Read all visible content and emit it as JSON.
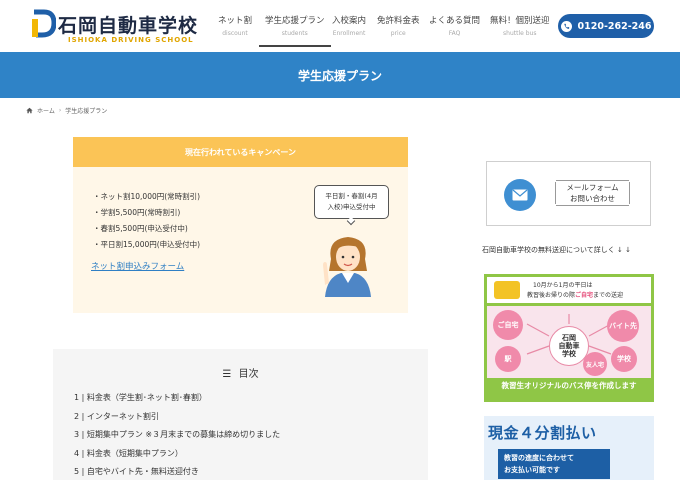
{
  "header": {
    "logo_title": "石岡自動車学校",
    "logo_sub": "ISHIOKA DRIVING SCHOOL",
    "nav": [
      {
        "label": "ネット割",
        "sub": "discount"
      },
      {
        "label": "学生応援プラン",
        "sub": "students"
      },
      {
        "label": "入校案内",
        "sub": "Enrollment"
      },
      {
        "label": "免許料金表",
        "sub": "price"
      },
      {
        "label": "よくある質問",
        "sub": "FAQ"
      },
      {
        "label": "無料！個別送迎",
        "sub": "shuttle bus"
      }
    ],
    "active_nav": "学生応援プラン",
    "tel": "0120-262-246",
    "colors": {
      "tel_button": "#1f5fa8"
    }
  },
  "page_title": "学生応援プラン",
  "breadcrumb": {
    "home": "ホーム",
    "current": "学生応援プラン"
  },
  "campaign": {
    "heading": "現在行われているキャンペーン",
    "items": [
      "・ネット割10,000円(常時割引)",
      "・学割5,500円(常時割引)",
      "・春割5,500円(申込受付中)",
      "・平日割15,000円(申込受付中)"
    ],
    "link": "ネット割申込みフォーム",
    "bubble_line1": "平日割・春割(4月",
    "bubble_line2": "入校)申込受付中",
    "colors": {
      "heading_bg": "#fbc456",
      "box_bg": "#fff7e8"
    }
  },
  "toc": {
    "title": "目次",
    "items": [
      "1 | 料金表（学生割･ネット割･春割）",
      "2 | インターネット割引",
      "3 | 短期集中プラン ※３月末までの募集は締め切りました",
      "4 | 料金表（短期集中プラン）",
      "5 | 自宅やバイト先・無料送迎付き"
    ]
  },
  "sidebar": {
    "mail_line1": "メールフォーム",
    "mail_line2": "お問い合わせ",
    "note": "石岡自動車学校の無料送迎について詳しく ↓ ↓",
    "bus_banner": {
      "line1": "10月から1月の平日は",
      "line2_pre": "教習後お帰りの際",
      "line2_em": "ご自宅",
      "line2_post": "までの送迎",
      "center": "石岡\n自動車\n学校",
      "nodes": [
        "ご自宅",
        "駅",
        "バイト先",
        "学校",
        "友人宅"
      ],
      "bottom": "教習生オリジナルのバス停を作成します"
    },
    "cash_banner": {
      "title": "現金４分割払い",
      "sub_line1": "教習の進度に合わせて",
      "sub_line2": "お支払い可能です"
    }
  }
}
